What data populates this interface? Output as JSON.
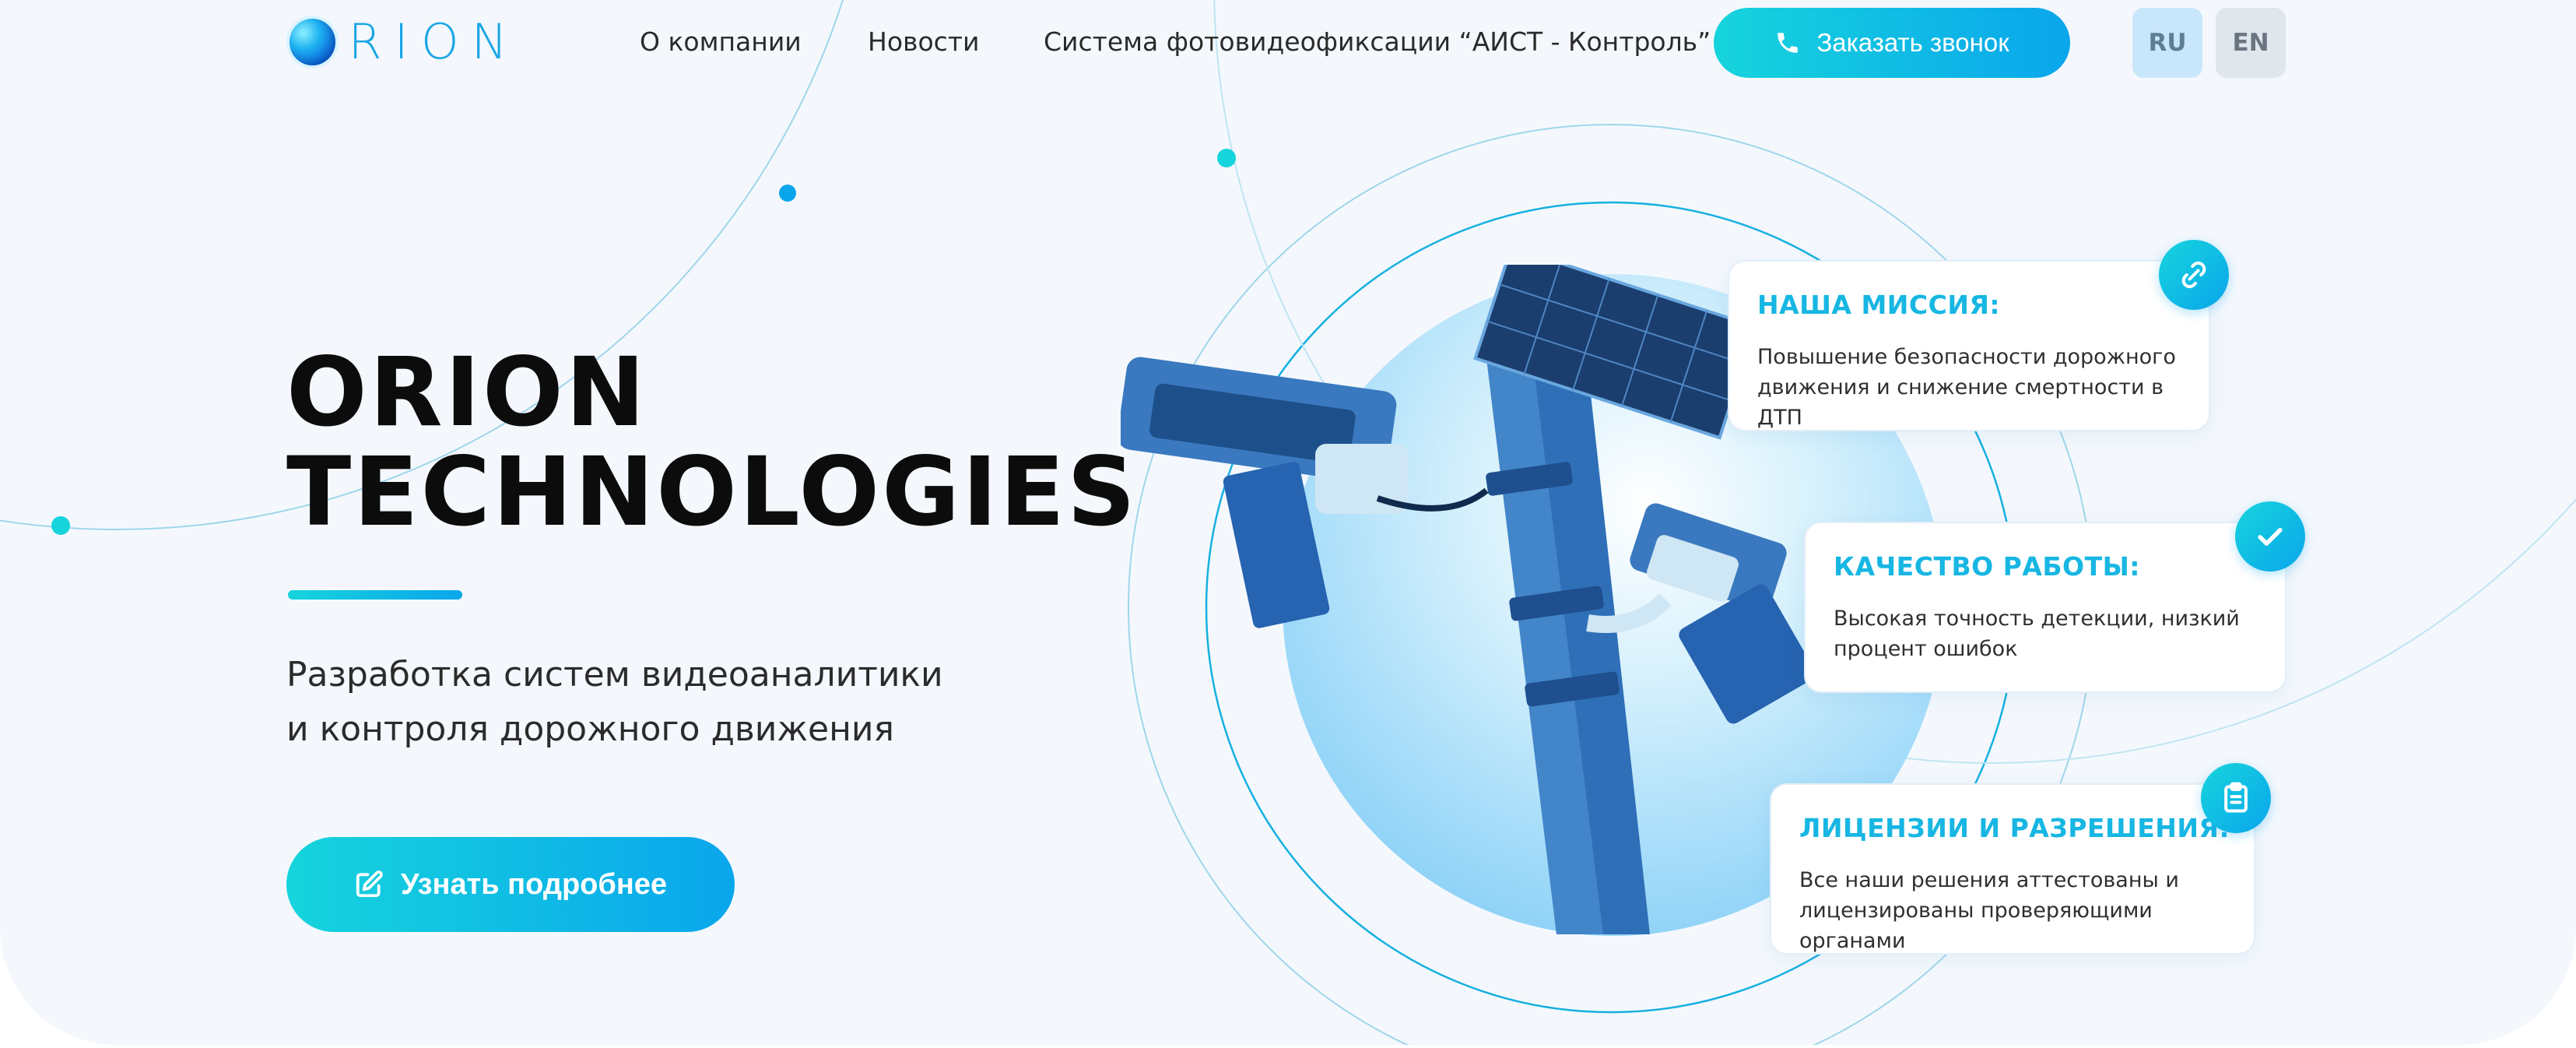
{
  "brand": {
    "logo_text": "RION",
    "accent_gradient": [
      "#16d4dc",
      "#0aa6ec"
    ],
    "title_color": "#0c0c0c",
    "card_title_color": "#17b6e3"
  },
  "header": {
    "nav": [
      {
        "label": "О компании"
      },
      {
        "label": "Новости"
      },
      {
        "label": "Система фотовидеофиксации “АИСТ - Контроль”"
      }
    ],
    "call_button": {
      "label": "Заказать звонок",
      "icon": "phone-icon"
    },
    "languages": [
      {
        "label": "RU",
        "active": true
      },
      {
        "label": "EN",
        "active": false
      }
    ]
  },
  "hero": {
    "title_line1": "ORION",
    "title_line2": "TECHNOLOGIES",
    "subtitle_line1": "Разработка систем видеоаналитики",
    "subtitle_line2": "и контроля дорожного движения",
    "cta_button": {
      "label": "Узнать подробнее",
      "icon": "edit-icon"
    }
  },
  "cards": [
    {
      "title": "НАША МИССИЯ:",
      "text": "Повышение безопасности дорожного движения и снижение смертности в ДТП",
      "icon": "link-icon"
    },
    {
      "title": "КАЧЕСТВО РАБОТЫ:",
      "text": "Высокая точность детекции, низкий процент ошибок",
      "icon": "check-icon"
    },
    {
      "title": "ЛИЦЕНЗИИ И РАЗРЕШЕНИЯ:",
      "text": "Все наши решения аттестованы и лицензированы проверяющими органами",
      "icon": "clipboard-icon"
    }
  ]
}
